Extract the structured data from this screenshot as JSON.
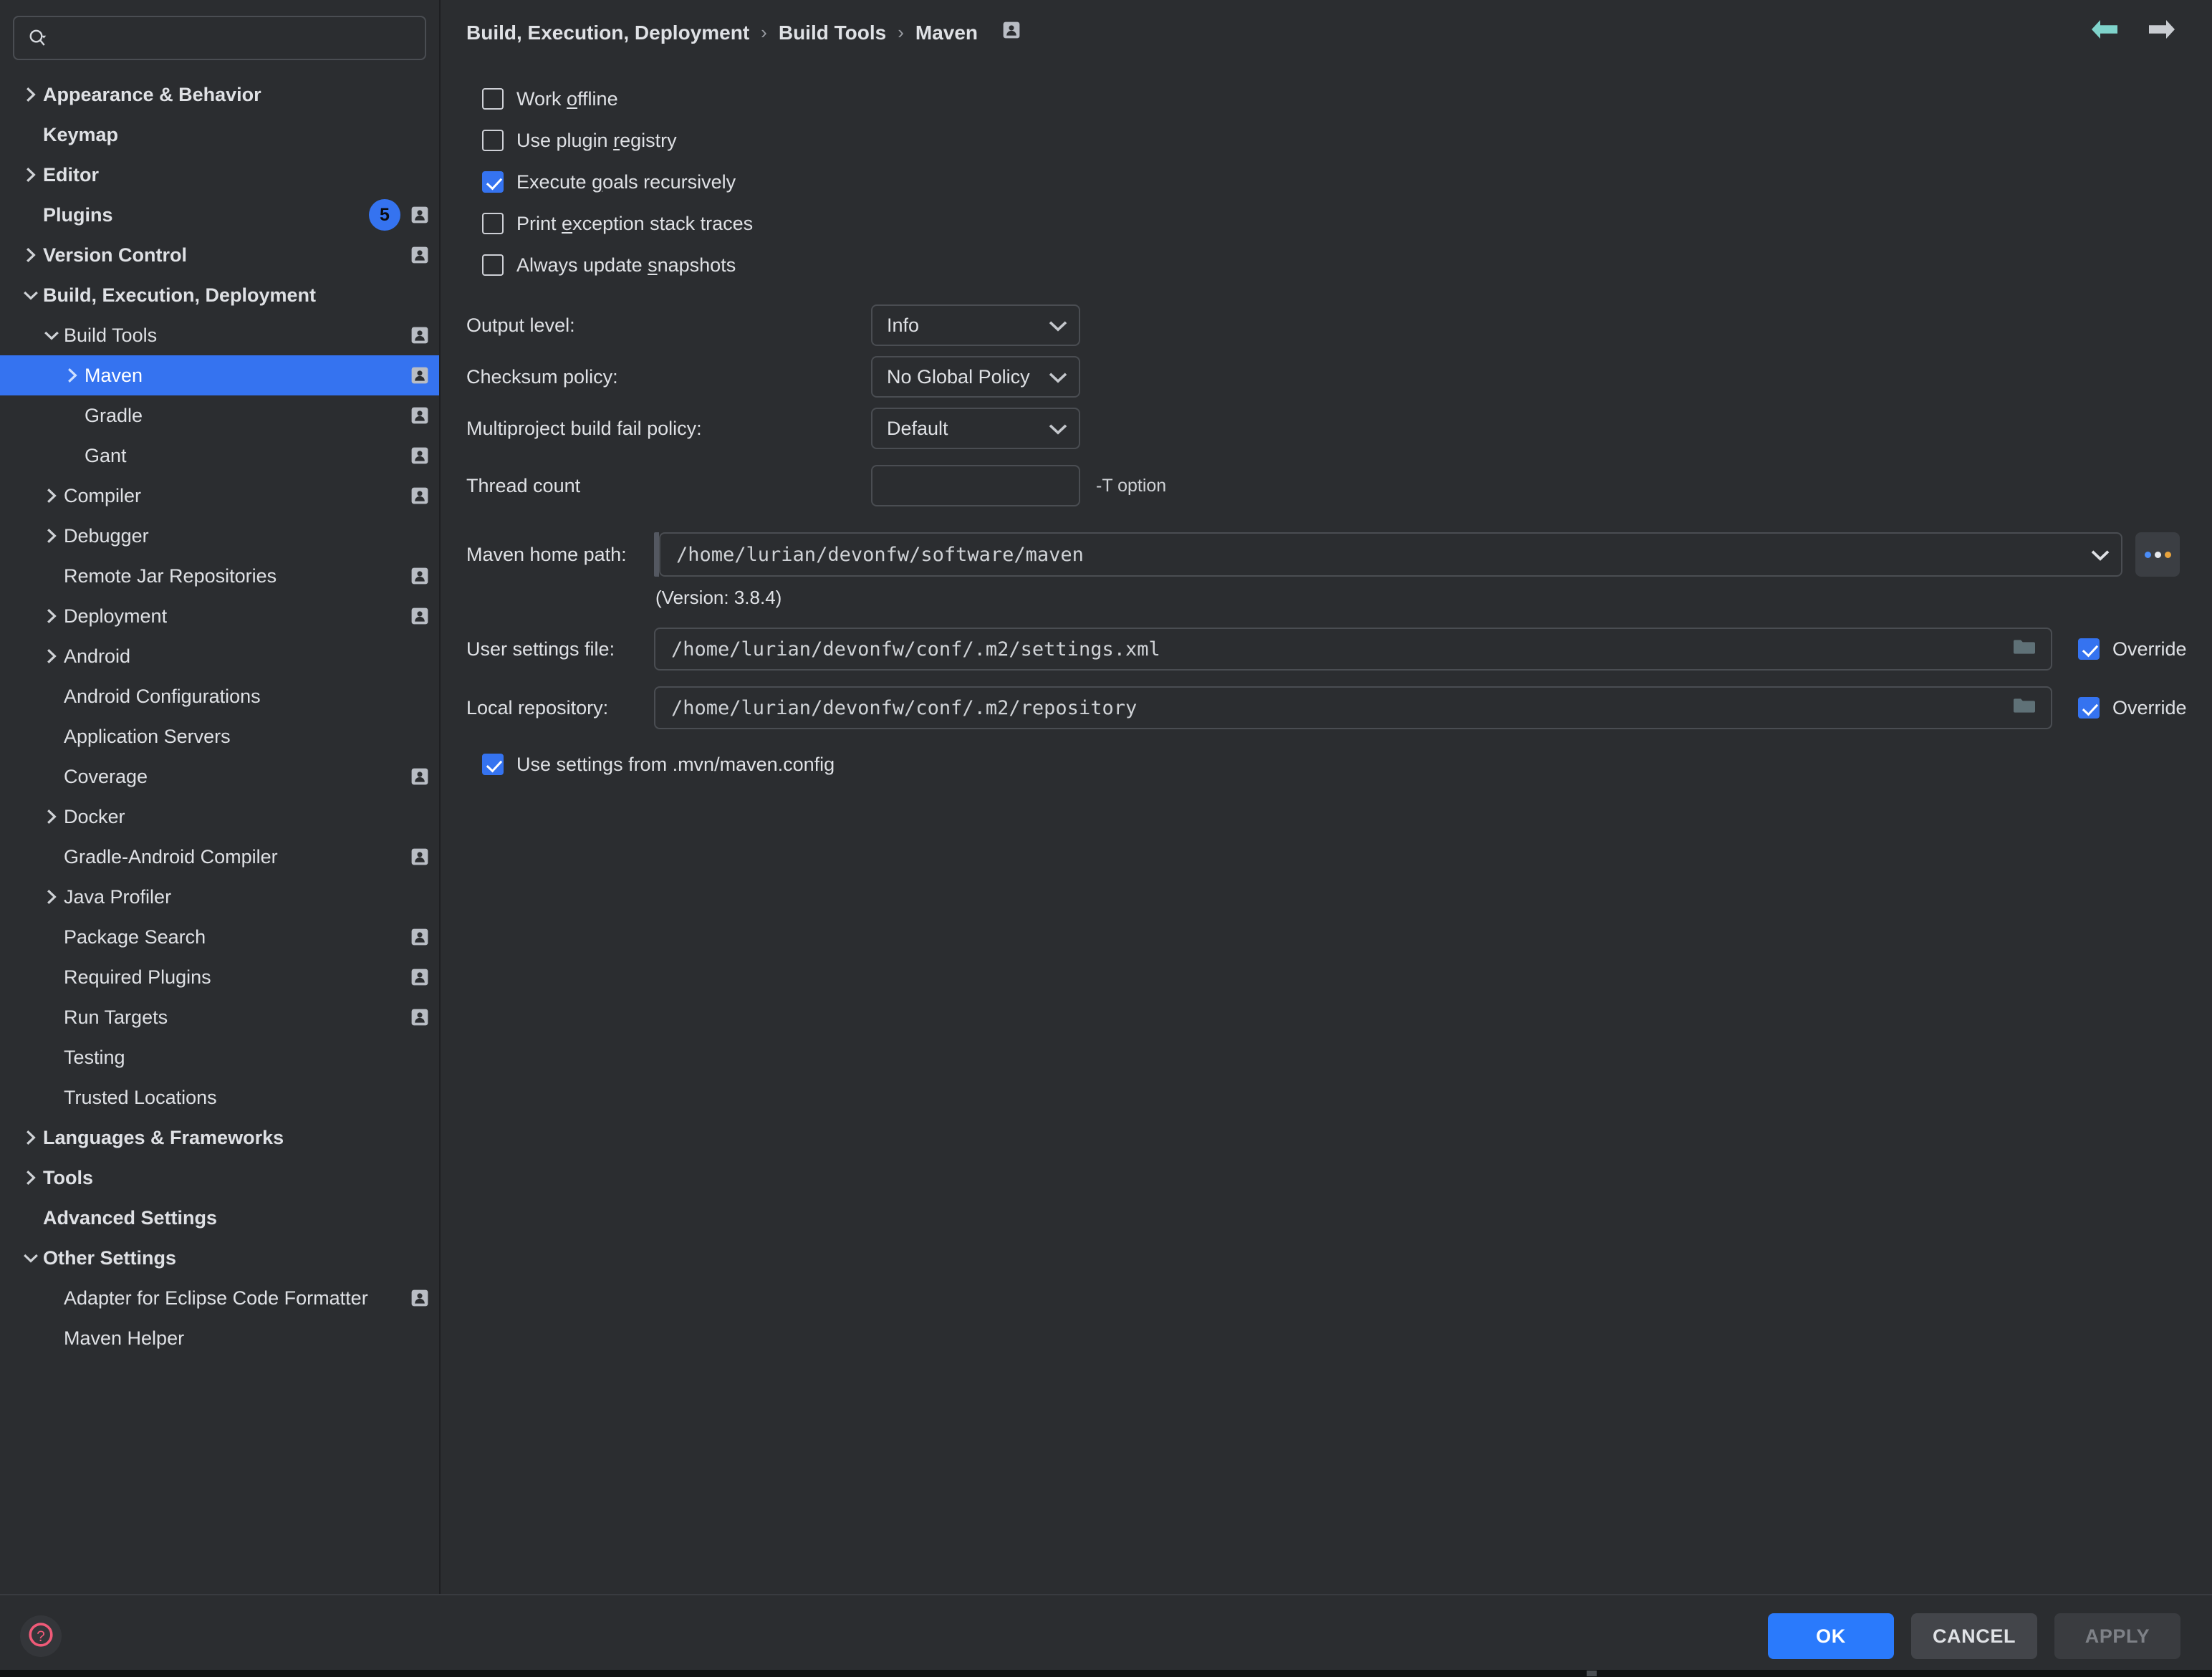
{
  "search": {
    "placeholder": "",
    "icon": "search-icon"
  },
  "sidebar": {
    "items": [
      {
        "label": "Appearance & Behavior",
        "indent": 0,
        "arrow": "right",
        "bold": true,
        "sync": false,
        "badge": null
      },
      {
        "label": "Keymap",
        "indent": 0,
        "arrow": "none",
        "bold": true,
        "sync": false,
        "badge": null
      },
      {
        "label": "Editor",
        "indent": 0,
        "arrow": "right",
        "bold": true,
        "sync": false,
        "badge": null
      },
      {
        "label": "Plugins",
        "indent": 0,
        "arrow": "none",
        "bold": true,
        "sync": true,
        "badge": "5"
      },
      {
        "label": "Version Control",
        "indent": 0,
        "arrow": "right",
        "bold": true,
        "sync": true,
        "badge": null
      },
      {
        "label": "Build, Execution, Deployment",
        "indent": 0,
        "arrow": "down",
        "bold": true,
        "sync": false,
        "badge": null
      },
      {
        "label": "Build Tools",
        "indent": 1,
        "arrow": "down",
        "bold": false,
        "sync": true,
        "badge": null
      },
      {
        "label": "Maven",
        "indent": 2,
        "arrow": "right",
        "bold": false,
        "sync": true,
        "badge": null,
        "selected": true
      },
      {
        "label": "Gradle",
        "indent": 2,
        "arrow": "none",
        "bold": false,
        "sync": true,
        "badge": null
      },
      {
        "label": "Gant",
        "indent": 2,
        "arrow": "none",
        "bold": false,
        "sync": true,
        "badge": null
      },
      {
        "label": "Compiler",
        "indent": 1,
        "arrow": "right",
        "bold": false,
        "sync": true,
        "badge": null
      },
      {
        "label": "Debugger",
        "indent": 1,
        "arrow": "right",
        "bold": false,
        "sync": false,
        "badge": null
      },
      {
        "label": "Remote Jar Repositories",
        "indent": 1,
        "arrow": "none",
        "bold": false,
        "sync": true,
        "badge": null
      },
      {
        "label": "Deployment",
        "indent": 1,
        "arrow": "right",
        "bold": false,
        "sync": true,
        "badge": null
      },
      {
        "label": "Android",
        "indent": 1,
        "arrow": "right",
        "bold": false,
        "sync": false,
        "badge": null
      },
      {
        "label": "Android Configurations",
        "indent": 1,
        "arrow": "none",
        "bold": false,
        "sync": false,
        "badge": null
      },
      {
        "label": "Application Servers",
        "indent": 1,
        "arrow": "none",
        "bold": false,
        "sync": false,
        "badge": null
      },
      {
        "label": "Coverage",
        "indent": 1,
        "arrow": "none",
        "bold": false,
        "sync": true,
        "badge": null
      },
      {
        "label": "Docker",
        "indent": 1,
        "arrow": "right",
        "bold": false,
        "sync": false,
        "badge": null
      },
      {
        "label": "Gradle-Android Compiler",
        "indent": 1,
        "arrow": "none",
        "bold": false,
        "sync": true,
        "badge": null
      },
      {
        "label": "Java Profiler",
        "indent": 1,
        "arrow": "right",
        "bold": false,
        "sync": false,
        "badge": null
      },
      {
        "label": "Package Search",
        "indent": 1,
        "arrow": "none",
        "bold": false,
        "sync": true,
        "badge": null
      },
      {
        "label": "Required Plugins",
        "indent": 1,
        "arrow": "none",
        "bold": false,
        "sync": true,
        "badge": null
      },
      {
        "label": "Run Targets",
        "indent": 1,
        "arrow": "none",
        "bold": false,
        "sync": true,
        "badge": null
      },
      {
        "label": "Testing",
        "indent": 1,
        "arrow": "none",
        "bold": false,
        "sync": false,
        "badge": null
      },
      {
        "label": "Trusted Locations",
        "indent": 1,
        "arrow": "none",
        "bold": false,
        "sync": false,
        "badge": null
      },
      {
        "label": "Languages & Frameworks",
        "indent": 0,
        "arrow": "right",
        "bold": true,
        "sync": false,
        "badge": null
      },
      {
        "label": "Tools",
        "indent": 0,
        "arrow": "right",
        "bold": true,
        "sync": false,
        "badge": null
      },
      {
        "label": "Advanced Settings",
        "indent": 0,
        "arrow": "none",
        "bold": true,
        "sync": false,
        "badge": null
      },
      {
        "label": "Other Settings",
        "indent": 0,
        "arrow": "down",
        "bold": true,
        "sync": false,
        "badge": null
      },
      {
        "label": "Adapter for Eclipse Code Formatter",
        "indent": 1,
        "arrow": "none",
        "bold": false,
        "sync": true,
        "badge": null
      },
      {
        "label": "Maven Helper",
        "indent": 1,
        "arrow": "none",
        "bold": false,
        "sync": false,
        "badge": null
      }
    ]
  },
  "breadcrumb": {
    "parts": [
      "Build, Execution, Deployment",
      "Build Tools",
      "Maven"
    ],
    "separator": "›",
    "sync_icon": "settings-sync-icon"
  },
  "nav": {
    "back_icon": "arrow-left-icon",
    "forward_icon": "arrow-right-icon",
    "back_color": "#7fd3cb",
    "forward_color": "#c9ccd1"
  },
  "main": {
    "checkboxes": [
      {
        "label_pre": "Work ",
        "mnemonic": "o",
        "label_post": "ffline",
        "checked": false,
        "name": "work-offline"
      },
      {
        "label_pre": "Use plugin ",
        "mnemonic": "r",
        "label_post": "egistry",
        "checked": false,
        "name": "use-plugin-registry"
      },
      {
        "label_pre": "Execute ",
        "mnemonic": "g",
        "label_post": "oals recursively",
        "checked": true,
        "name": "execute-goals-recursively"
      },
      {
        "label_pre": "Print ",
        "mnemonic": "e",
        "label_post": "xception stack traces",
        "checked": false,
        "name": "print-exception-stack-traces"
      },
      {
        "label_pre": "Always update ",
        "mnemonic": "s",
        "label_post": "napshots",
        "checked": false,
        "name": "always-update-snapshots"
      }
    ],
    "output_level": {
      "label": "Output level:",
      "value": "Info"
    },
    "checksum_policy": {
      "label": "Checksum policy:",
      "value": "No Global Policy"
    },
    "multiproject_fail_policy": {
      "label": "Multiproject build fail policy:",
      "value": "Default"
    },
    "thread_count": {
      "label": "Thread count",
      "value": "",
      "hint": "-T option"
    },
    "maven_home": {
      "label": "Maven home path:",
      "value": "/home/lurian/devonfw/software/maven",
      "version": "(Version: 3.8.4)",
      "browse_label": "..."
    },
    "user_settings": {
      "label": "User settings file:",
      "value": "/home/lurian/devonfw/conf/.m2/settings.xml",
      "override_label": "Override",
      "override_checked": true
    },
    "local_repository": {
      "label": "Local repository:",
      "value": "/home/lurian/devonfw/conf/.m2/repository",
      "override_label": "Override",
      "override_checked": true
    },
    "mvn_config": {
      "label": "Use settings from .mvn/maven.config",
      "checked": true
    }
  },
  "footer": {
    "help_icon": "help-question-icon",
    "ok_label": "OK",
    "cancel_label": "CANCEL",
    "apply_label": "APPLY"
  },
  "colors": {
    "accent": "#3573f0",
    "primary_button": "#2a7afc",
    "background": "#2b2d30",
    "selection": "#3573f0",
    "help": "#f05a78",
    "back_arrow": "#7fd3cb"
  }
}
